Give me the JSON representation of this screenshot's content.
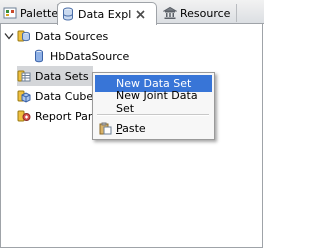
{
  "tabs": [
    {
      "label": "Palette"
    },
    {
      "label": "Data Expl"
    },
    {
      "label": "Resource"
    }
  ],
  "tree": {
    "data_sources": "Data Sources",
    "hb_data_source": "HbDataSource",
    "data_sets": "Data Sets",
    "data_cubes": "Data Cubes",
    "report_params": "Report Para"
  },
  "context_menu": {
    "new_data_set": "New Data Set",
    "new_joint_data_set": "New Joint Data Set",
    "paste_first": "P",
    "paste_rest": "aste"
  },
  "colors": {
    "highlight": "#3875d7",
    "selected_row": "#d4d6d9"
  }
}
